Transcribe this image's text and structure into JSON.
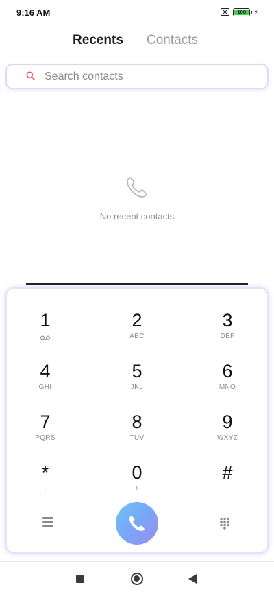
{
  "status_bar": {
    "time": "9:16 AM",
    "battery_level": "100",
    "icons": [
      "sim-off-icon",
      "battery-icon",
      "charging-bolt-icon"
    ]
  },
  "tabs": [
    {
      "label": "Recents",
      "active": true
    },
    {
      "label": "Contacts",
      "active": false
    }
  ],
  "search": {
    "placeholder": "Search contacts",
    "value": ""
  },
  "recents": {
    "empty_message": "No recent contacts"
  },
  "dialpad": {
    "keys": [
      {
        "digit": "1",
        "letters": ""
      },
      {
        "digit": "2",
        "letters": "ABC"
      },
      {
        "digit": "3",
        "letters": "DEF"
      },
      {
        "digit": "4",
        "letters": "GHI"
      },
      {
        "digit": "5",
        "letters": "JKL"
      },
      {
        "digit": "6",
        "letters": "MNO"
      },
      {
        "digit": "7",
        "letters": "PQRS"
      },
      {
        "digit": "8",
        "letters": "TUV"
      },
      {
        "digit": "9",
        "letters": "WXYZ"
      },
      {
        "digit": "*",
        "letters": ","
      },
      {
        "digit": "0",
        "letters": "+"
      },
      {
        "digit": "#",
        "letters": ""
      }
    ]
  },
  "colors": {
    "accent_search": "#e2546e",
    "call_gradient_start": "#6ec2f8",
    "call_gradient_end": "#9a8ef2",
    "battery_green": "#43d34a"
  }
}
